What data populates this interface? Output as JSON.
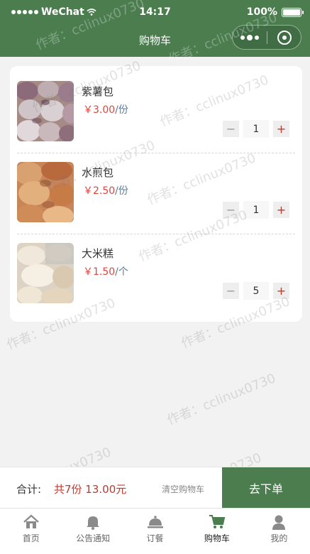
{
  "status_bar": {
    "carrier": "WeChat",
    "time": "14:17",
    "battery": "100%"
  },
  "nav": {
    "title": "购物车"
  },
  "cart": {
    "items": [
      {
        "name": "紫薯包",
        "price": "￥3.00",
        "unit": "/份",
        "quantity": "1",
        "minus": "−",
        "plus": "+"
      },
      {
        "name": "水煎包",
        "price": "￥2.50",
        "unit": "/份",
        "quantity": "1",
        "minus": "−",
        "plus": "+"
      },
      {
        "name": "大米糕",
        "price": "￥1.50",
        "unit": "/个",
        "quantity": "5",
        "minus": "−",
        "plus": "+"
      }
    ]
  },
  "order_bar": {
    "total_label": "合计:",
    "total_value": "共7份 13.00元",
    "clear_label": "清空购物车",
    "checkout_label": "去下单"
  },
  "tab_bar": {
    "tabs": [
      {
        "label": "首页",
        "icon": "home-icon"
      },
      {
        "label": "公告通知",
        "icon": "bell-icon"
      },
      {
        "label": "订餐",
        "icon": "cloche-icon"
      },
      {
        "label": "购物车",
        "icon": "cart-icon",
        "active": true
      },
      {
        "label": "我的",
        "icon": "user-icon"
      }
    ]
  },
  "watermark": {
    "text": "作者：cclinux0730"
  },
  "colors": {
    "brand_green": "#4b7d4f",
    "price_red": "#e0443c",
    "unit_blue": "#5b7a9c",
    "background": "#f2f2f2"
  }
}
